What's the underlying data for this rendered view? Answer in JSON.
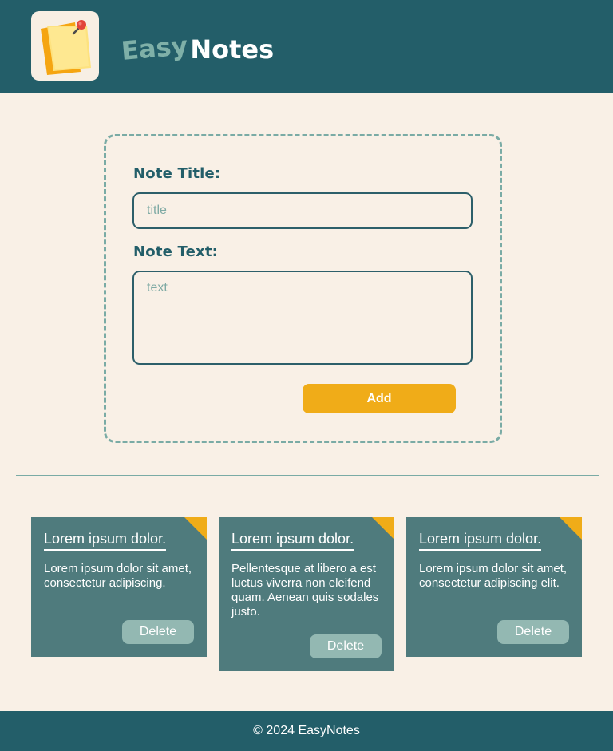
{
  "header": {
    "brand_easy": "Easy",
    "brand_notes": "Notes",
    "logo_icon": "sticky-note-pin-icon"
  },
  "form": {
    "title_label": "Note Title:",
    "title_placeholder": "title",
    "text_label": "Note Text:",
    "text_placeholder": "text",
    "add_label": "Add"
  },
  "notes": [
    {
      "title": "Lorem ipsum dolor.",
      "text": "Lorem ipsum dolor sit amet, consectetur adipiscing.",
      "delete_label": "Delete"
    },
    {
      "title": "Lorem ipsum dolor.",
      "text": "Pellentesque at libero a est luctus viverra non eleifend quam. Aenean quis sodales justo.",
      "delete_label": "Delete"
    },
    {
      "title": "Lorem ipsum dolor.",
      "text": "Lorem ipsum dolor sit amet, consectetur adipiscing elit.",
      "delete_label": "Delete"
    }
  ],
  "footer": {
    "text": "© 2024 EasyNotes"
  },
  "colors": {
    "header_bg": "#235e69",
    "page_bg": "#f9f0e6",
    "accent": "#f0ac18",
    "note_bg": "#4f7b7d",
    "delete_bg": "#93b8b2"
  }
}
